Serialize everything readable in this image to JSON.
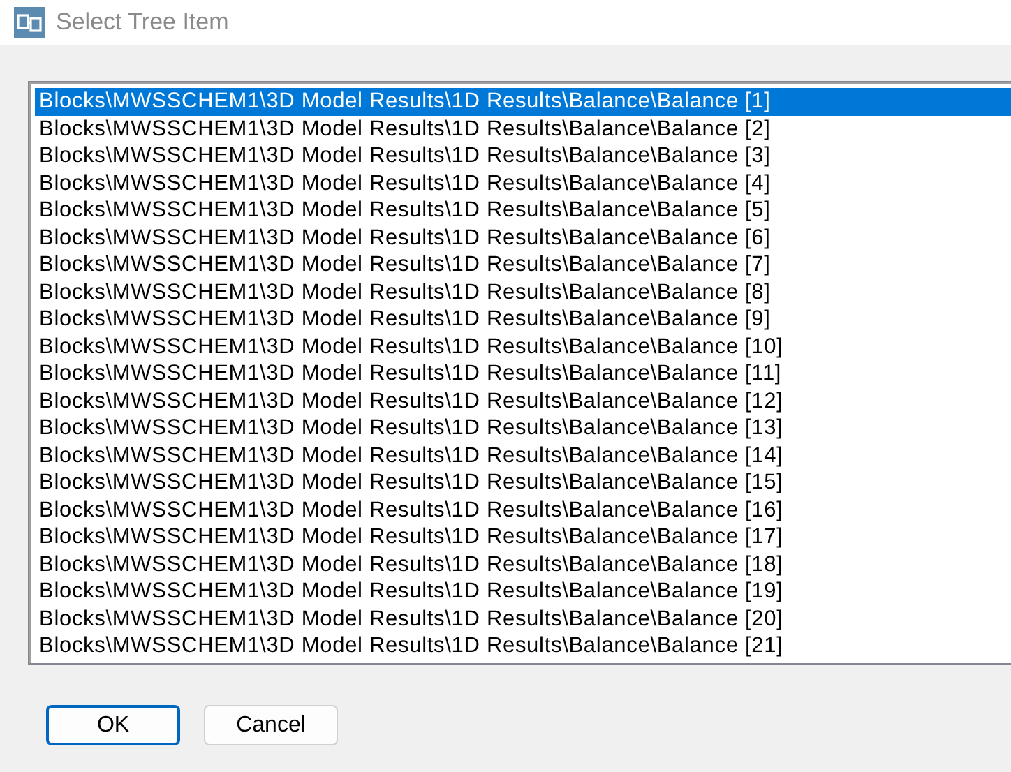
{
  "window": {
    "title": "Select Tree Item"
  },
  "list": {
    "items": [
      {
        "label": "Blocks\\MWSSCHEM1\\3D Model Results\\1D Results\\Balance\\Balance [1]",
        "selected": true
      },
      {
        "label": "Blocks\\MWSSCHEM1\\3D Model Results\\1D Results\\Balance\\Balance [2]",
        "selected": false
      },
      {
        "label": "Blocks\\MWSSCHEM1\\3D Model Results\\1D Results\\Balance\\Balance [3]",
        "selected": false
      },
      {
        "label": "Blocks\\MWSSCHEM1\\3D Model Results\\1D Results\\Balance\\Balance [4]",
        "selected": false
      },
      {
        "label": "Blocks\\MWSSCHEM1\\3D Model Results\\1D Results\\Balance\\Balance [5]",
        "selected": false
      },
      {
        "label": "Blocks\\MWSSCHEM1\\3D Model Results\\1D Results\\Balance\\Balance [6]",
        "selected": false
      },
      {
        "label": "Blocks\\MWSSCHEM1\\3D Model Results\\1D Results\\Balance\\Balance [7]",
        "selected": false
      },
      {
        "label": "Blocks\\MWSSCHEM1\\3D Model Results\\1D Results\\Balance\\Balance [8]",
        "selected": false
      },
      {
        "label": "Blocks\\MWSSCHEM1\\3D Model Results\\1D Results\\Balance\\Balance [9]",
        "selected": false
      },
      {
        "label": "Blocks\\MWSSCHEM1\\3D Model Results\\1D Results\\Balance\\Balance [10]",
        "selected": false
      },
      {
        "label": "Blocks\\MWSSCHEM1\\3D Model Results\\1D Results\\Balance\\Balance [11]",
        "selected": false
      },
      {
        "label": "Blocks\\MWSSCHEM1\\3D Model Results\\1D Results\\Balance\\Balance [12]",
        "selected": false
      },
      {
        "label": "Blocks\\MWSSCHEM1\\3D Model Results\\1D Results\\Balance\\Balance [13]",
        "selected": false
      },
      {
        "label": "Blocks\\MWSSCHEM1\\3D Model Results\\1D Results\\Balance\\Balance [14]",
        "selected": false
      },
      {
        "label": "Blocks\\MWSSCHEM1\\3D Model Results\\1D Results\\Balance\\Balance [15]",
        "selected": false
      },
      {
        "label": "Blocks\\MWSSCHEM1\\3D Model Results\\1D Results\\Balance\\Balance [16]",
        "selected": false
      },
      {
        "label": "Blocks\\MWSSCHEM1\\3D Model Results\\1D Results\\Balance\\Balance [17]",
        "selected": false
      },
      {
        "label": "Blocks\\MWSSCHEM1\\3D Model Results\\1D Results\\Balance\\Balance [18]",
        "selected": false
      },
      {
        "label": "Blocks\\MWSSCHEM1\\3D Model Results\\1D Results\\Balance\\Balance [19]",
        "selected": false
      },
      {
        "label": "Blocks\\MWSSCHEM1\\3D Model Results\\1D Results\\Balance\\Balance [20]",
        "selected": false
      },
      {
        "label": "Blocks\\MWSSCHEM1\\3D Model Results\\1D Results\\Balance\\Balance [21]",
        "selected": false
      }
    ]
  },
  "buttons": [
    {
      "label": "OK",
      "default": true
    },
    {
      "label": "Cancel",
      "default": false
    }
  ]
}
